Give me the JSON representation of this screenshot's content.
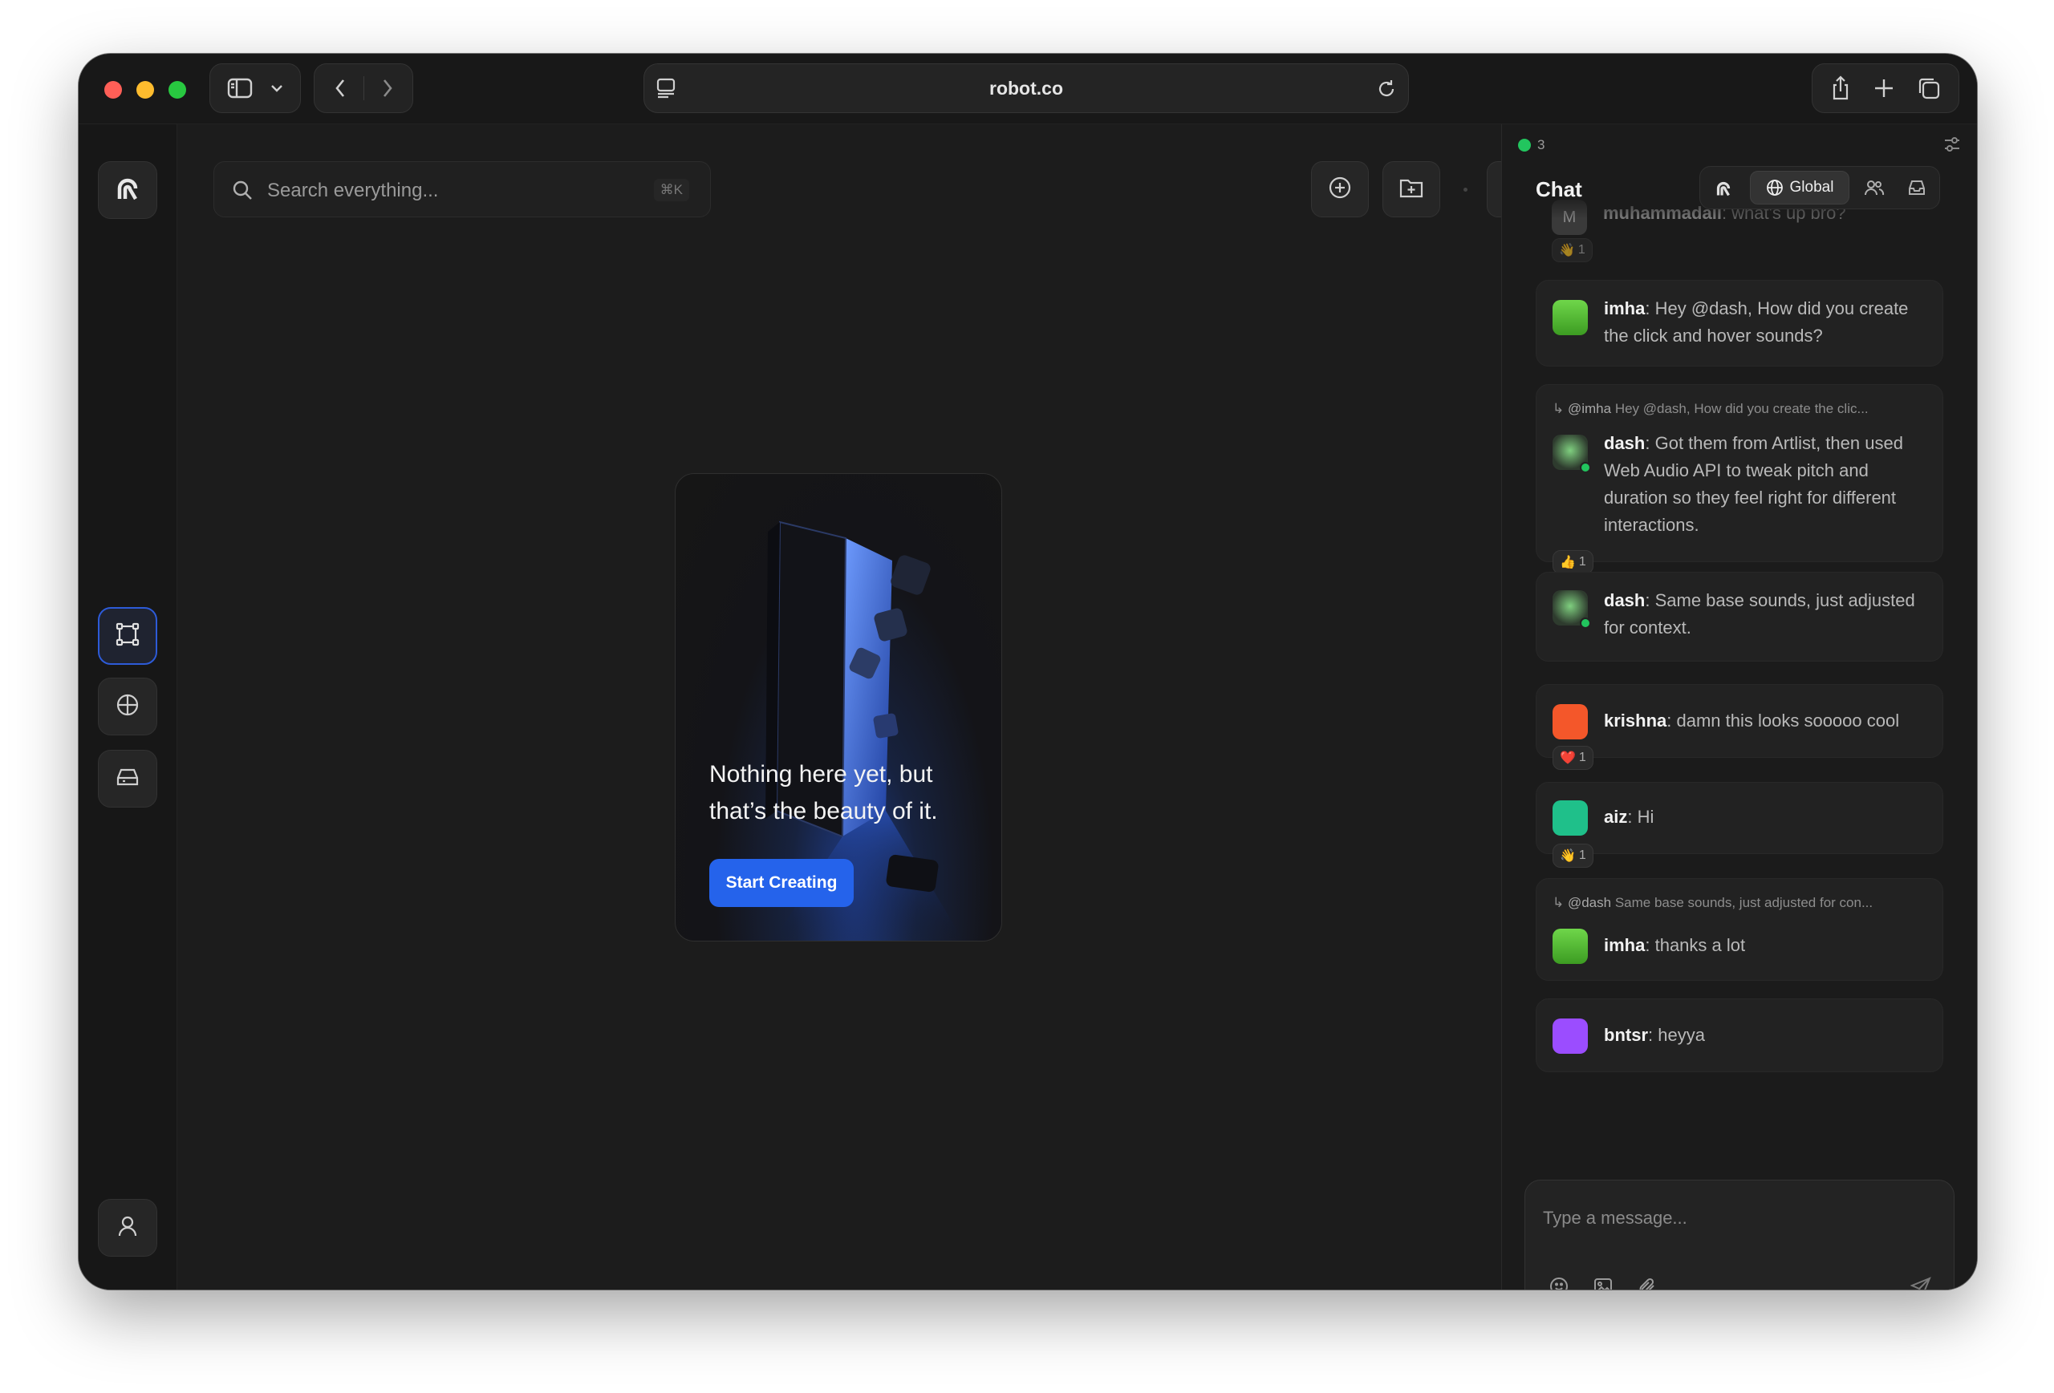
{
  "browser": {
    "url": "robot.co"
  },
  "main": {
    "search_placeholder": "Search everything...",
    "search_shortcut": "⌘K",
    "empty_state": {
      "title_line1": "Nothing here yet, but",
      "title_line2": "that’s the beauty of it.",
      "button_label": "Start Creating"
    }
  },
  "chat": {
    "online_count": "3",
    "title": "Chat",
    "tab_global": "Global",
    "messages": [
      {
        "user": "muhammadali",
        "text": "what's up bro?",
        "reaction": "👋",
        "reaction_count": "1",
        "avatar_color": "#3a3a3a",
        "avatar_letter": "M"
      },
      {
        "user": "imha",
        "text": "Hey @dash, How did you create the click and hover sounds?",
        "avatar_color": "#4caf2a"
      },
      {
        "reply_to": "@imha",
        "reply_text": "Hey @dash, How did you create the clic...",
        "user": "dash",
        "text": "Got them from Artlist, then used Web Audio API to tweak pitch and duration so they feel right for different interactions.",
        "reaction": "👍",
        "reaction_count": "1",
        "avatar_color": "#2e3b2e"
      },
      {
        "user": "dash",
        "text": "Same base sounds, just adjusted for context.",
        "avatar_color": "#2e3b2e"
      },
      {
        "user": "krishna",
        "text": "damn this looks sooooo cool",
        "reaction": "❤️",
        "reaction_count": "1",
        "avatar_color": "#f4572a"
      },
      {
        "user": "aiz",
        "text": "Hi",
        "reaction": "👋",
        "reaction_count": "1",
        "avatar_color": "#1fc08a"
      },
      {
        "reply_to": "@dash",
        "reply_text": "Same base sounds, just adjusted for con...",
        "user": "imha",
        "text": "thanks a lot",
        "avatar_color": "#4caf2a"
      },
      {
        "user": "bntsr",
        "text": "heyya",
        "avatar_color": "#9b4dff"
      }
    ],
    "composer_placeholder": "Type a message..."
  }
}
